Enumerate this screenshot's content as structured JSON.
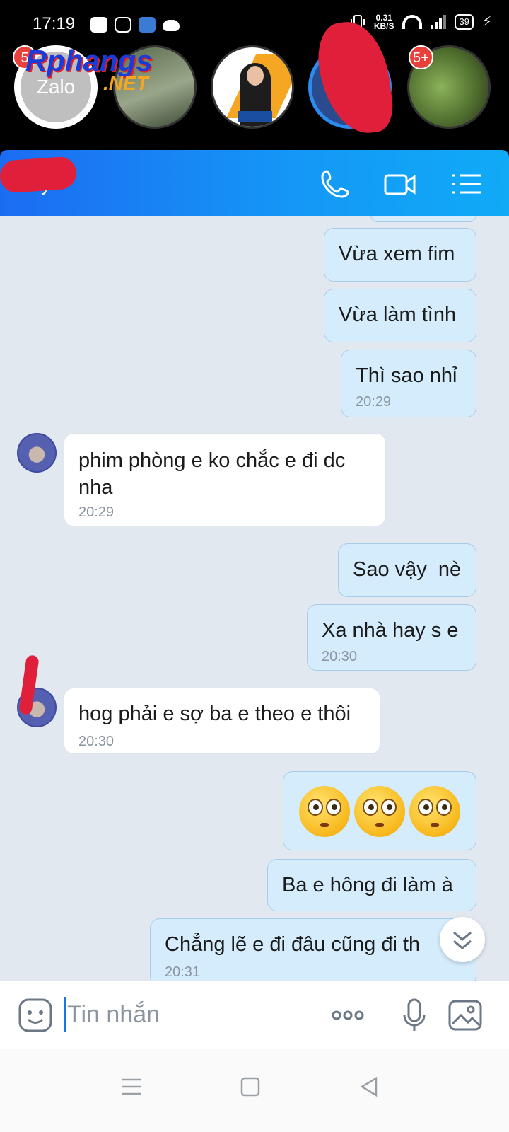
{
  "status_bar": {
    "time": "17:19",
    "net_speed_value": "0.31",
    "net_speed_unit": "KB/S",
    "battery": "39",
    "icons": [
      "zalo-icon",
      "instagram-icon",
      "hotspot-icon",
      "cloud-icon",
      "vibrate-icon",
      "wifi-icon",
      "signal-icon",
      "battery-icon",
      "charging-icon"
    ]
  },
  "chat_heads": {
    "zalo_label": "Zalo",
    "badge_left": "5",
    "badge_right": "5+"
  },
  "watermark": {
    "text": "Rphangs",
    "suffix": ".NET"
  },
  "header": {
    "contact_name": "y",
    "actions": [
      "phone-icon",
      "video-call-icon",
      "list-menu-icon"
    ]
  },
  "messages": [
    {
      "dir": "out",
      "text": "Vừa xem fim",
      "time": ""
    },
    {
      "dir": "out",
      "text": "Vừa làm tình",
      "time": ""
    },
    {
      "dir": "out",
      "text": "Thì sao nhỉ",
      "time": "20:29"
    },
    {
      "dir": "in",
      "text_line1": "phim phòng e ko chắc e đi dc",
      "text_line2": "nha",
      "time": "20:29"
    },
    {
      "dir": "out",
      "text": "Sao vậy  nè",
      "time": ""
    },
    {
      "dir": "out",
      "text": "Xa nhà hay s e",
      "time": "20:30"
    },
    {
      "dir": "in",
      "text": "hog phải e sợ ba e theo e thôi",
      "time": "20:30"
    },
    {
      "dir": "out",
      "emojis": [
        "flushed-face",
        "flushed-face",
        "flushed-face"
      ]
    },
    {
      "dir": "out",
      "text": "Ba e hông đi làm à",
      "time": ""
    },
    {
      "dir": "out",
      "text": "Chẳng lẽ e đi đâu cũng đi th",
      "time": "20:31"
    }
  ],
  "composer": {
    "placeholder": "Tin nhắn"
  },
  "colors": {
    "header_start": "#1c6cf2",
    "header_end": "#10aaf7",
    "outgoing_bubble": "#d5ecfc",
    "incoming_bubble": "#ffffff",
    "chat_background": "#e2e8ef"
  }
}
